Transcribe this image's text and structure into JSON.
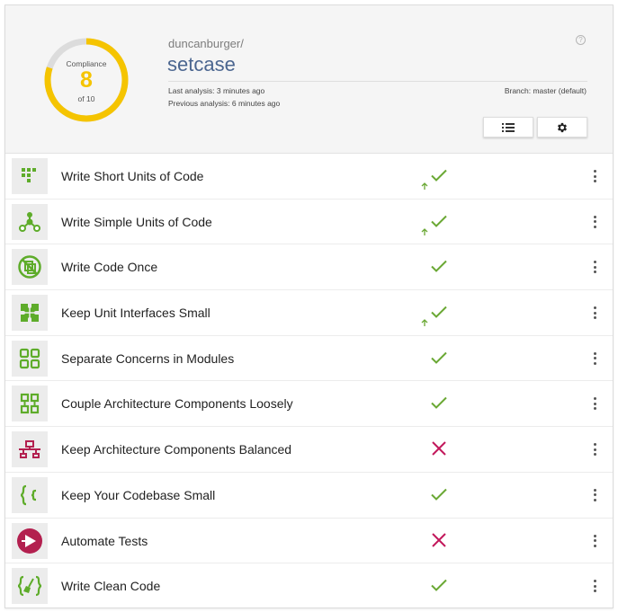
{
  "header": {
    "compliance_label": "Compliance",
    "score": "8",
    "score_total": "of 10",
    "score_fraction": 0.8,
    "owner": "duncanburger/",
    "repo": "setcase",
    "last_analysis": "Last analysis: 3 minutes ago",
    "previous_analysis": "Previous analysis: 6 minutes ago",
    "branch": "Branch: master (default)",
    "help_glyph": "?",
    "icons": {
      "list": "list-icon",
      "settings": "gear-icon",
      "help": "help-icon"
    },
    "colors": {
      "gauge": "#f5c400",
      "gauge_track": "#dcdcdc",
      "repo": "#4b6690"
    }
  },
  "colors": {
    "pass": "#6aa834",
    "fail": "#c2185b",
    "icon_green": "#5eac2a",
    "icon_red": "#b3204f"
  },
  "guidelines": [
    {
      "label": "Write Short Units of Code",
      "status": "pass",
      "trend_up": true,
      "icon": "short-units-icon"
    },
    {
      "label": "Write Simple Units of Code",
      "status": "pass",
      "trend_up": true,
      "icon": "simple-units-icon"
    },
    {
      "label": "Write Code Once",
      "status": "pass",
      "trend_up": false,
      "icon": "no-duplication-icon"
    },
    {
      "label": "Keep Unit Interfaces Small",
      "status": "pass",
      "trend_up": true,
      "icon": "puzzle-icon"
    },
    {
      "label": "Separate Concerns in Modules",
      "status": "pass",
      "trend_up": false,
      "icon": "modules-icon"
    },
    {
      "label": "Couple Architecture Components Loosely",
      "status": "pass",
      "trend_up": false,
      "icon": "components-icon"
    },
    {
      "label": "Keep Architecture Components Balanced",
      "status": "fail",
      "trend_up": false,
      "icon": "balance-icon"
    },
    {
      "label": "Keep Your Codebase Small",
      "status": "pass",
      "trend_up": false,
      "icon": "braces-icon"
    },
    {
      "label": "Automate Tests",
      "status": "fail",
      "trend_up": false,
      "icon": "play-test-icon"
    },
    {
      "label": "Write Clean Code",
      "status": "pass",
      "trend_up": false,
      "icon": "broom-icon"
    }
  ]
}
